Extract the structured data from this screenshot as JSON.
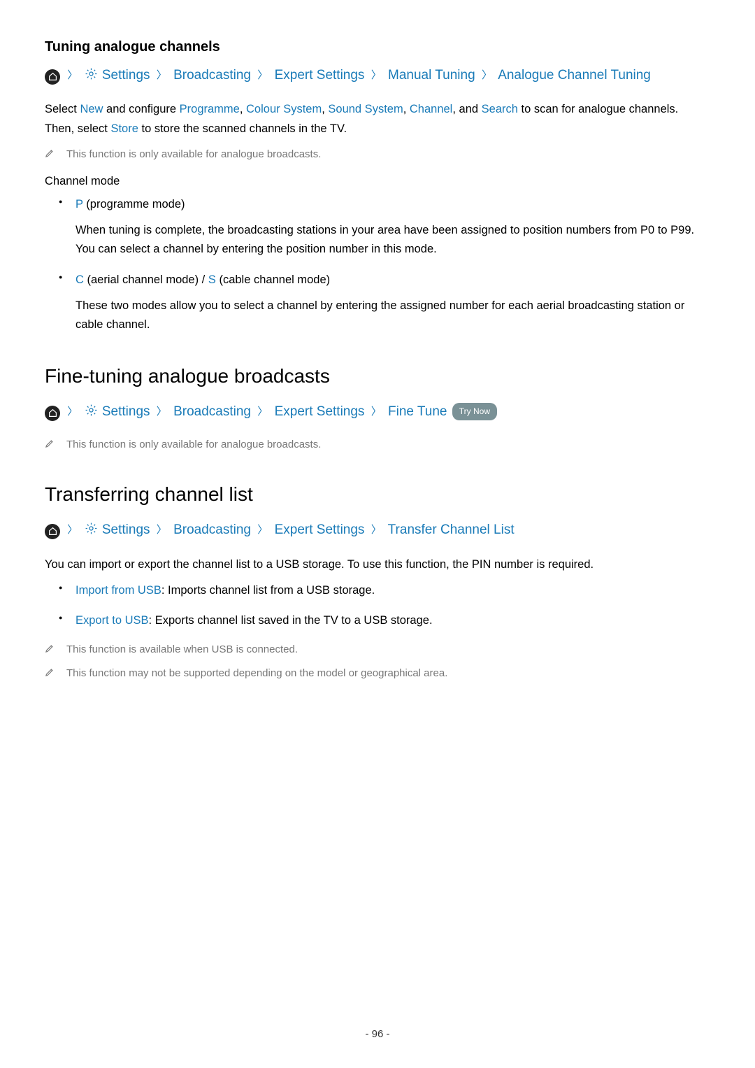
{
  "section1": {
    "title": "Tuning analogue channels",
    "breadcrumb": [
      "Settings",
      "Broadcasting",
      "Expert Settings",
      "Manual Tuning",
      "Analogue Channel Tuning"
    ],
    "paragraph_parts": {
      "p1_a": "Select ",
      "p1_new": "New",
      "p1_b": " and configure ",
      "p1_prog": "Programme",
      "p1_c": ", ",
      "p1_colour": "Colour System",
      "p1_d": ", ",
      "p1_sound": "Sound System",
      "p1_e": ", ",
      "p1_channel": "Channel",
      "p1_f": ", and ",
      "p1_search": "Search",
      "p1_g": " to scan for analogue channels. Then, select ",
      "p1_store": "Store",
      "p1_h": " to store the scanned channels in the TV."
    },
    "note": "This function is only available for analogue broadcasts.",
    "channel_mode_label": "Channel mode",
    "modes": [
      {
        "code": "P",
        "label": " (programme mode)",
        "desc": "When tuning is complete, the broadcasting stations in your area have been assigned to position numbers from P0 to P99. You can select a channel by entering the position number in this mode."
      },
      {
        "code": "C",
        "label_a": " (aerial channel mode) / ",
        "code2": "S",
        "label_b": " (cable channel mode)",
        "desc": "These two modes allow you to select a channel by entering the assigned number for each aerial broadcasting station or cable channel."
      }
    ]
  },
  "section2": {
    "title": "Fine-tuning analogue broadcasts",
    "breadcrumb": [
      "Settings",
      "Broadcasting",
      "Expert Settings",
      "Fine Tune"
    ],
    "try_now": "Try Now",
    "note": "This function is only available for analogue broadcasts."
  },
  "section3": {
    "title": "Transferring channel list",
    "breadcrumb": [
      "Settings",
      "Broadcasting",
      "Expert Settings",
      "Transfer Channel List"
    ],
    "intro": "You can import or export the channel list to a USB storage. To use this function, the PIN number is required.",
    "items": [
      {
        "term": "Import from USB",
        "desc": ": Imports channel list from a USB storage."
      },
      {
        "term": "Export to USB",
        "desc": ": Exports channel list saved in the TV to a USB storage."
      }
    ],
    "notes": [
      "This function is available when USB is connected.",
      "This function may not be supported depending on the model or geographical area."
    ]
  },
  "page_number": "- 96 -"
}
